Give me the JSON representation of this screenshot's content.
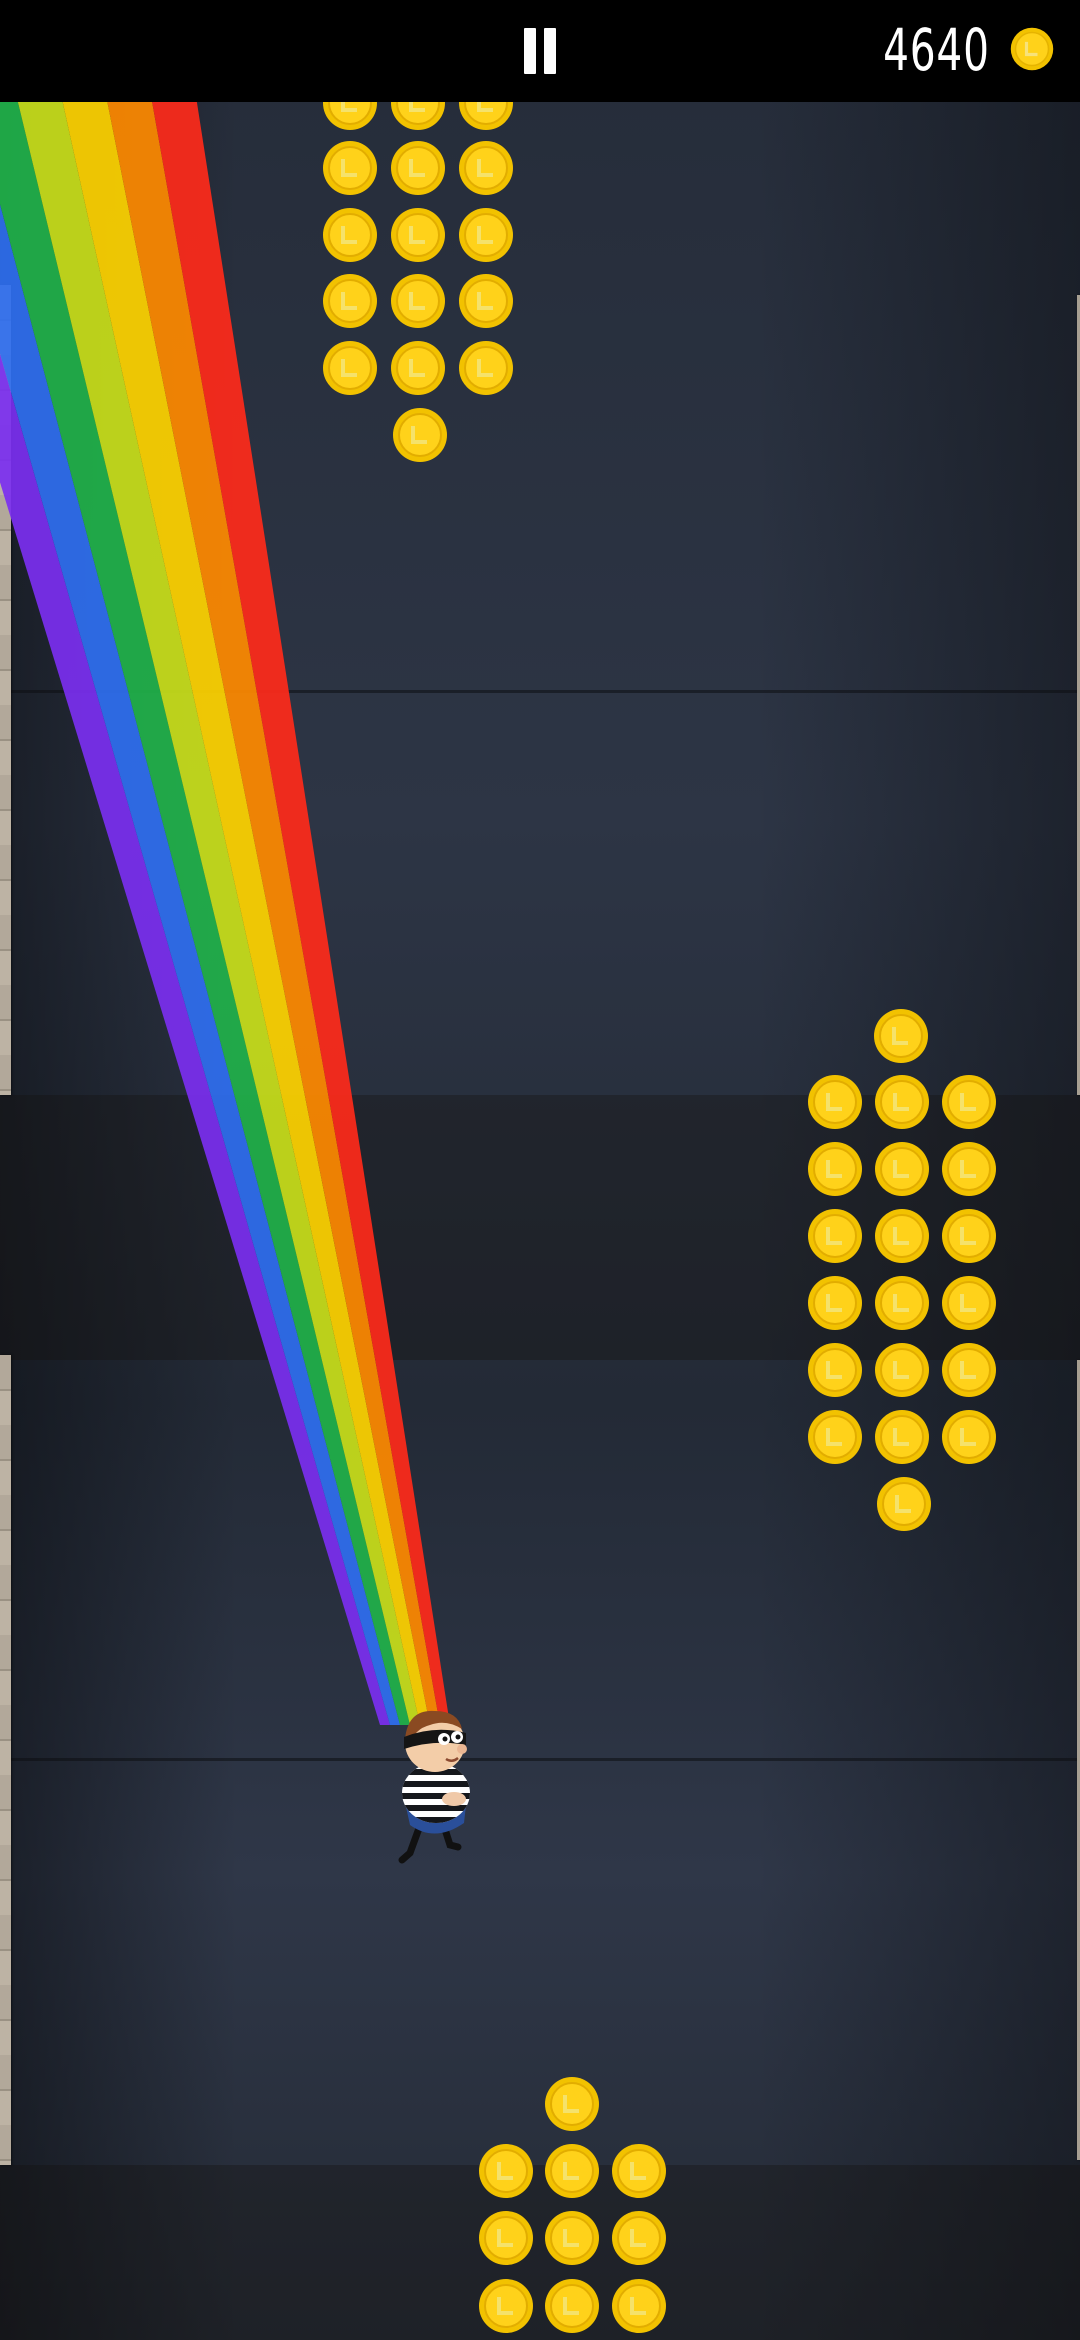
{
  "hud": {
    "score": "4640",
    "pause_icon": "pause-icon",
    "coin_icon": "coin-icon"
  },
  "colors": {
    "coin_outer": "#f2c200",
    "coin_inner": "#ffd21a",
    "coin_mark": "#f5e26b",
    "rainbow": [
      "#7b2ff0",
      "#2f6ff0",
      "#21b24a",
      "#c9e01a",
      "#ffd400",
      "#ff8a00",
      "#ff2a1a"
    ]
  },
  "player": {
    "icon": "robber-character-icon",
    "outfit": "striped-shirt"
  }
}
